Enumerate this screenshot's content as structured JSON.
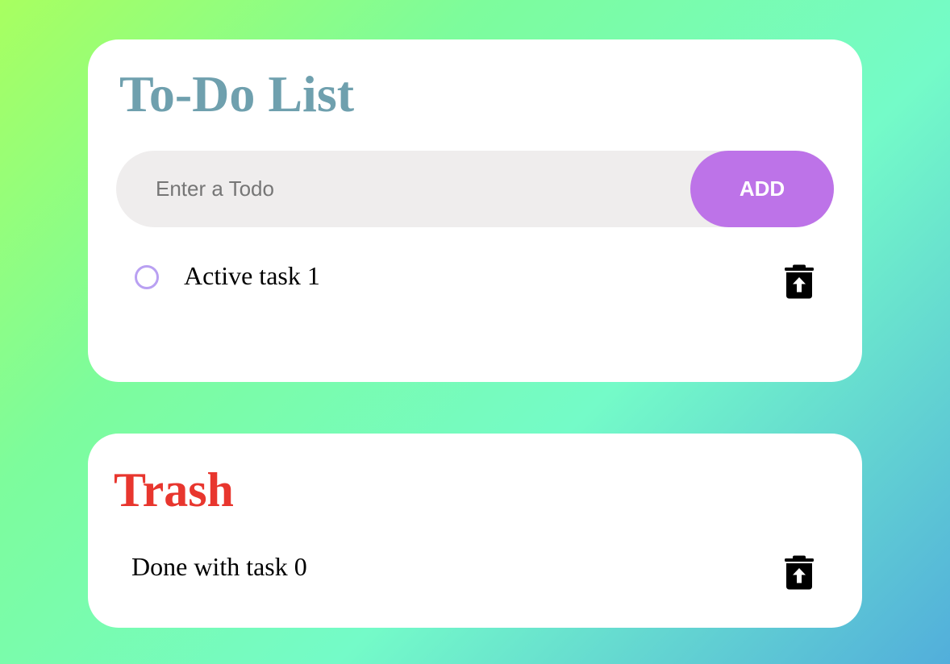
{
  "todo_panel": {
    "title": "To-Do List",
    "input": {
      "placeholder": "Enter a Todo",
      "value": ""
    },
    "add_button_label": "ADD",
    "tasks": [
      {
        "text": "Active task 1",
        "completed": false,
        "action_icon": "trash-restore-icon"
      }
    ]
  },
  "trash_panel": {
    "title": "Trash",
    "tasks": [
      {
        "text": "Done with task 0",
        "action_icon": "trash-restore-icon"
      }
    ]
  },
  "colors": {
    "background_gradient": [
      "#a8ff60",
      "#74fbc8",
      "#52aedb"
    ],
    "todo_title": "#6fa0ae",
    "trash_title": "#e8362e",
    "add_button": "#bd73e8",
    "checkbox_border": "#b9a0f2",
    "input_background": "#efeded"
  }
}
